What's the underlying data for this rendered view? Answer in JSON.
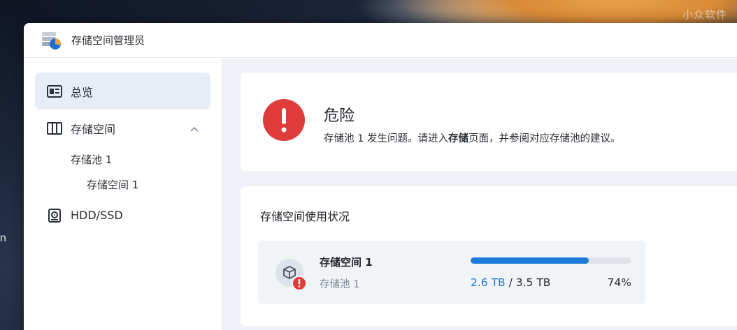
{
  "desktop": {
    "watermark": "小众软件",
    "edge_letter": "n"
  },
  "window": {
    "title": "存储空间管理员",
    "app_icon": "storage-manager-icon"
  },
  "sidebar": {
    "items": [
      {
        "label": "总览",
        "icon": "overview-card-icon",
        "active": true
      },
      {
        "label": "存储空间",
        "icon": "storage-panel-icon",
        "expanded": true,
        "children": [
          {
            "label": "存储池 1",
            "children": [
              {
                "label": "存储空间 1"
              }
            ]
          }
        ]
      },
      {
        "label": "HDD/SSD",
        "icon": "disk-icon"
      }
    ]
  },
  "alert": {
    "title": "危险",
    "message_pre": "存储池 1 发生问题。请进入",
    "message_bold": "存储",
    "message_post": "页面，并参阅对应存储池的建议。",
    "icon": "danger-icon",
    "color": "#e03b3b"
  },
  "usage": {
    "title": "存储空间使用状况",
    "volumes": [
      {
        "name": "存储空间 1",
        "pool": "存储池 1",
        "used": "2.6 TB",
        "separator": " / ",
        "total": "3.5 TB",
        "percent_label": "74%",
        "percent": 0.74,
        "bar_color": "#1c7ad8"
      }
    ]
  }
}
